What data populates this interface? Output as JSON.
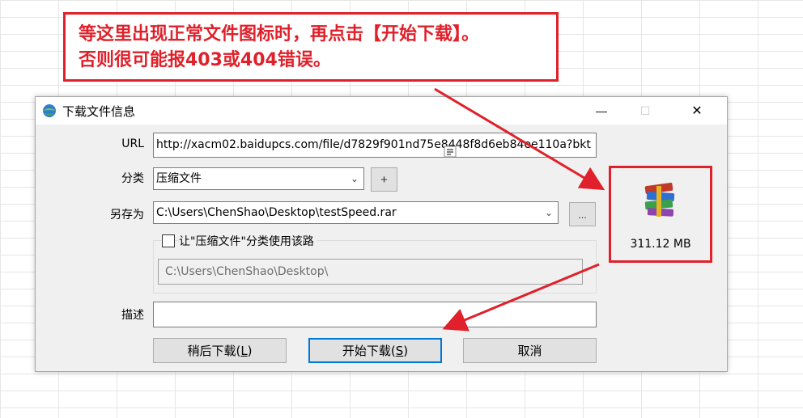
{
  "annotation": {
    "line1": "等这里出现正常文件图标时，再点击【开始下载】。",
    "line2": "否则很可能报403或404错误。"
  },
  "dialog": {
    "title": "下载文件信息",
    "url_label": "URL",
    "url_value": "http://xacm02.baidupcs.com/file/d7829f901nd75e8448f8d6eb84ee110a?bkt",
    "category_label": "分类",
    "category_value": "压缩文件",
    "category_add": "+",
    "saveas_label": "另存为",
    "saveas_value": "C:\\Users\\ChenShao\\Desktop\\testSpeed.rar",
    "browse_label": "...",
    "use_path_label": "让\"压缩文件\"分类使用该路",
    "use_path_checked": false,
    "category_path": "C:\\Users\\ChenShao\\Desktop\\",
    "desc_label": "描述",
    "desc_value": "",
    "file_size": "311.12  MB",
    "buttons": {
      "later": "稍后下载(",
      "later_key": "L",
      "start": "开始下载(",
      "start_key": "S",
      "cancel": "取消"
    },
    "close_char": "✕",
    "max_char": "☐",
    "min_char": "—"
  },
  "colors": {
    "annotation_red": "#e0202a",
    "default_button_border": "#0078d7"
  },
  "icons": [
    "idm-app-icon",
    "winrar-file-icon",
    "clipboard-icon",
    "chevron-down-icon"
  ]
}
